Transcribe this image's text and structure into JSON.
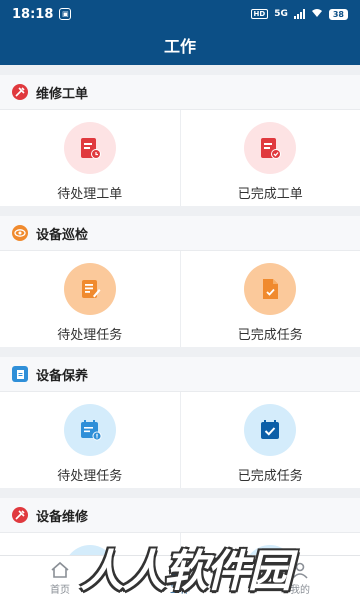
{
  "status_bar": {
    "time": "18:18",
    "network": "5G",
    "battery": "38"
  },
  "appbar": {
    "title": "工作"
  },
  "sections": [
    {
      "title": "维修工单",
      "icon": "wrench-hammer-icon",
      "items": [
        {
          "label": "待处理工单",
          "icon": "pending-order-icon"
        },
        {
          "label": "已完成工单",
          "icon": "completed-order-icon"
        }
      ]
    },
    {
      "title": "设备巡检",
      "icon": "eye-icon",
      "items": [
        {
          "label": "待处理任务",
          "icon": "pending-task-icon"
        },
        {
          "label": "已完成任务",
          "icon": "completed-task-icon"
        }
      ]
    },
    {
      "title": "设备保养",
      "icon": "document-icon",
      "items": [
        {
          "label": "待处理任务",
          "icon": "calendar-pending-icon"
        },
        {
          "label": "已完成任务",
          "icon": "calendar-check-icon"
        }
      ]
    },
    {
      "title": "设备维修",
      "icon": "wrench-hammer-icon",
      "items": [
        {
          "label": "",
          "icon": "repair-pending-icon"
        },
        {
          "label": "",
          "icon": "repair-completed-icon"
        }
      ]
    }
  ],
  "tabbar": {
    "items": [
      {
        "label": "首页",
        "icon": "home-icon",
        "active": false
      },
      {
        "label": "工作",
        "icon": "briefcase-icon",
        "active": true
      },
      {
        "label": "我的",
        "icon": "user-icon",
        "active": false
      }
    ]
  },
  "watermark": "人人软件园",
  "colors": {
    "primary": "#0c4f86",
    "section1": "#e0393e",
    "section2": "#f08a2e",
    "section3": "#2f8fd8",
    "section4": "#e0393e"
  }
}
